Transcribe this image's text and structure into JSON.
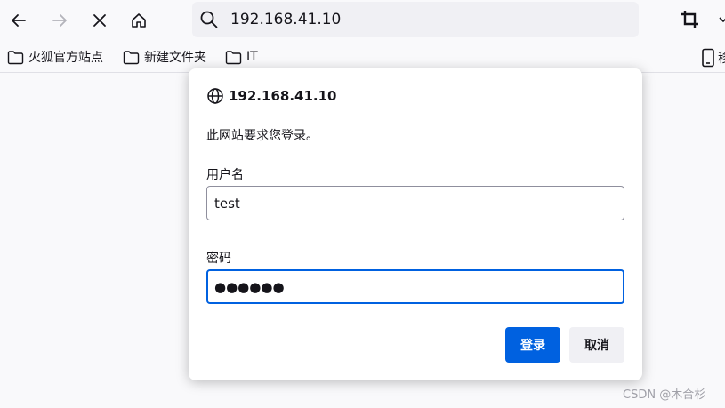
{
  "toolbar": {
    "url": "192.168.41.10"
  },
  "bookmarks": {
    "items": [
      "火狐官方站点",
      "新建文件夹",
      "IT"
    ],
    "mobile_label": "移"
  },
  "dialog": {
    "host": "192.168.41.10",
    "message": "此网站要求您登录。",
    "username_label": "用户名",
    "username_value": "test",
    "password_label": "密码",
    "password_mask": "●●●●●●",
    "login_button": "登录",
    "cancel_button": "取消"
  },
  "watermark": "CSDN @木合杉",
  "colors": {
    "accent": "#0061e0",
    "toolbar_bg": "#f9f9fb",
    "urlbar_bg": "#f0f0f4"
  }
}
